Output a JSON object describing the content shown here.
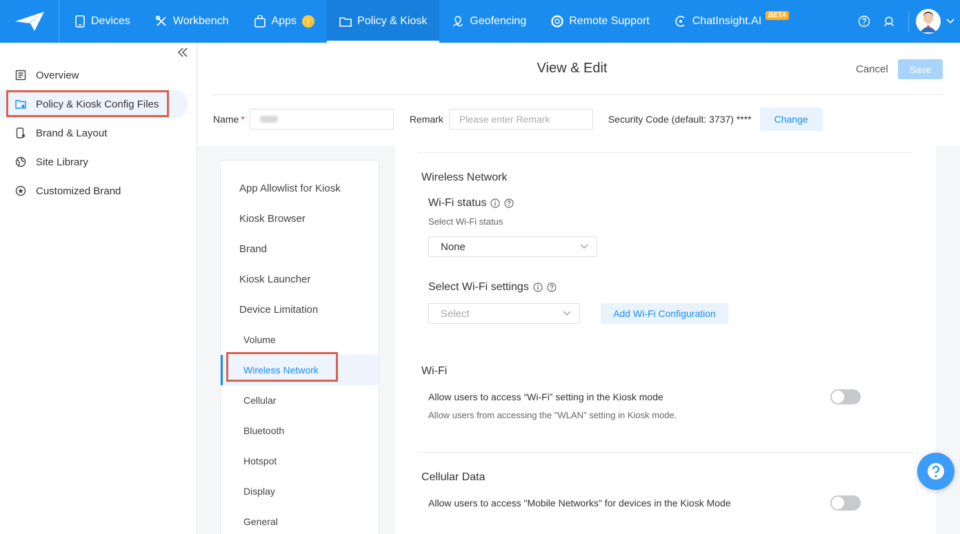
{
  "nav": {
    "items": [
      {
        "label": "Devices",
        "icon": "tablet-icon"
      },
      {
        "label": "Workbench",
        "icon": "tools-icon"
      },
      {
        "label": "Apps",
        "icon": "apps-bag-icon"
      },
      {
        "label": "Policy & Kiosk",
        "icon": "folder-icon"
      },
      {
        "label": "Geofencing",
        "icon": "map-pin-icon"
      },
      {
        "label": "Remote Support",
        "icon": "lifebuoy-icon"
      },
      {
        "label": "ChatInsight.AI",
        "icon": "ai-chat-icon"
      }
    ],
    "apps_update_badge": "↑",
    "beta_badge": "BETA",
    "active": "Policy & Kiosk"
  },
  "sidebar": {
    "items": [
      {
        "label": "Overview",
        "icon": "document-icon"
      },
      {
        "label": "Policy & Kiosk Config Files",
        "icon": "folder-settings-icon"
      },
      {
        "label": "Brand & Layout",
        "icon": "phone-settings-icon"
      },
      {
        "label": "Site Library",
        "icon": "globe-icon"
      },
      {
        "label": "Customized Brand",
        "icon": "star-circle-icon"
      }
    ],
    "active": "Policy & Kiosk Config Files"
  },
  "header": {
    "title": "View & Edit",
    "cancel_label": "Cancel",
    "save_label": "Save",
    "name_label": "Name",
    "name_required": "*",
    "name_value": "test",
    "remark_label": "Remark",
    "remark_placeholder": "Please enter Remark",
    "security_label": "Security Code (default: 3737) ****",
    "change_label": "Change"
  },
  "submenu": {
    "items": [
      {
        "label": "App Allowlist for Kiosk",
        "level": 1
      },
      {
        "label": "Kiosk Browser",
        "level": 1
      },
      {
        "label": "Brand",
        "level": 1
      },
      {
        "label": "Kiosk Launcher",
        "level": 1
      },
      {
        "label": "Device Limitation",
        "level": 1
      },
      {
        "label": "Volume",
        "level": 2
      },
      {
        "label": "Wireless Network",
        "level": 2
      },
      {
        "label": "Cellular",
        "level": 2
      },
      {
        "label": "Bluetooth",
        "level": 2
      },
      {
        "label": "Hotspot",
        "level": 2
      },
      {
        "label": "Display",
        "level": 2
      },
      {
        "label": "General",
        "level": 2
      }
    ],
    "active": "Wireless Network"
  },
  "wireless": {
    "title": "Wireless Network",
    "wifi_status_label": "Wi-Fi status",
    "wifi_status_hint": "Select Wi-Fi status",
    "wifi_status_value": "None",
    "wifi_settings_label": "Select Wi-Fi settings",
    "wifi_settings_placeholder": "Select",
    "add_wifi_label": "Add Wi-Fi Configuration"
  },
  "wifi": {
    "title": "Wi-Fi",
    "allow_label": "Allow users to access “Wi-Fi” setting in the Kiosk mode",
    "allow_desc": "Allow users from accessing the \"WLAN\" setting in Kiosk mode.",
    "enabled": false
  },
  "cellular": {
    "title": "Cellular Data",
    "allow_label": "Allow users to access \"Mobile Networks\" for devices in the Kiosk Mode",
    "enabled": false
  },
  "colors": {
    "brand": "#1a8cf0",
    "highlight": "#d9614c"
  }
}
